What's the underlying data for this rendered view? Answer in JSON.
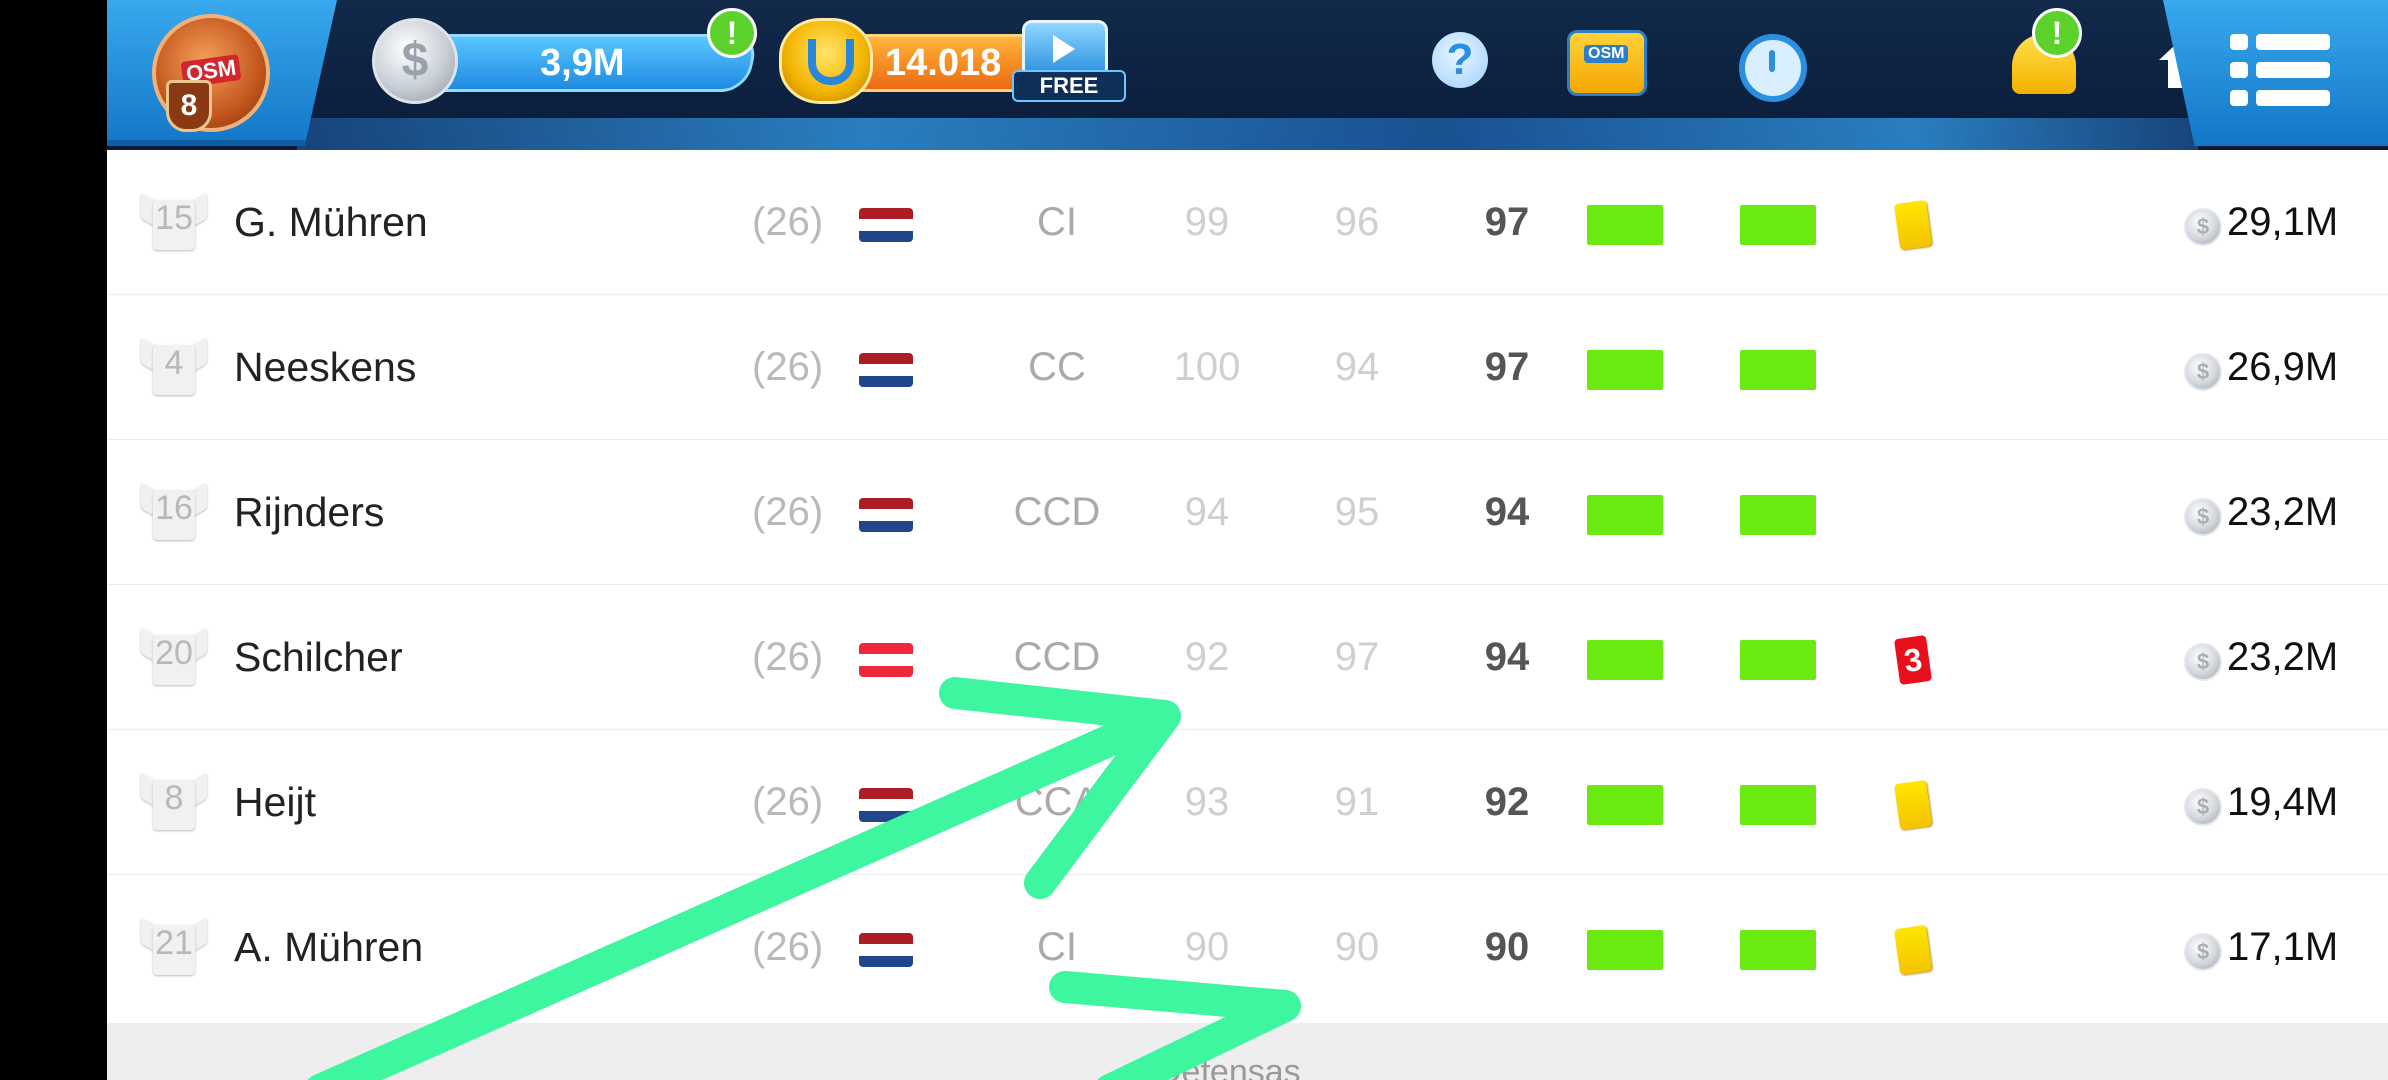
{
  "header": {
    "logo_text": "OSM",
    "level": "8",
    "coins": "3,9M",
    "coins_alert": "!",
    "boss_coins": "14.018",
    "boss_alert": "!",
    "free_video_label": "FREE",
    "help_glyph": "?",
    "bag_label": "OSM",
    "bell_alert": "!",
    "icons": [
      "coin-icon",
      "bosscoin-icon",
      "video-camera-icon",
      "help-icon",
      "shop-bag-icon",
      "stopwatch-icon",
      "bell-icon",
      "home-icon",
      "menu-icon"
    ]
  },
  "players": [
    {
      "number": "15",
      "name": "G. Mühren",
      "age": "(26)",
      "flag": "netherlands",
      "position": "CI",
      "stat1": "99",
      "stat2": "96",
      "overall": "97",
      "card": "yellow",
      "card_text": "",
      "value": "29,1M"
    },
    {
      "number": "4",
      "name": "Neeskens",
      "age": "(26)",
      "flag": "netherlands",
      "position": "CC",
      "stat1": "100",
      "stat2": "94",
      "overall": "97",
      "card": "",
      "card_text": "",
      "value": "26,9M"
    },
    {
      "number": "16",
      "name": "Rijnders",
      "age": "(26)",
      "flag": "netherlands",
      "position": "CCD",
      "stat1": "94",
      "stat2": "95",
      "overall": "94",
      "card": "",
      "card_text": "",
      "value": "23,2M"
    },
    {
      "number": "20",
      "name": "Schilcher",
      "age": "(26)",
      "flag": "austria",
      "position": "CCD",
      "stat1": "92",
      "stat2": "97",
      "overall": "94",
      "card": "red",
      "card_text": "3",
      "value": "23,2M"
    },
    {
      "number": "8",
      "name": "Heijt",
      "age": "(26)",
      "flag": "netherlands",
      "position": "CCA",
      "stat1": "93",
      "stat2": "91",
      "overall": "92",
      "card": "yellow",
      "card_text": "",
      "value": "19,4M"
    },
    {
      "number": "21",
      "name": "A. Mühren",
      "age": "(26)",
      "flag": "netherlands",
      "position": "CI",
      "stat1": "90",
      "stat2": "90",
      "overall": "90",
      "card": "yellow",
      "card_text": "",
      "value": "17,1M"
    }
  ],
  "footer": {
    "section_label": "Defensas"
  },
  "colors": {
    "accent_green": "#6bea12",
    "annotation_arrow": "#3ef5a0",
    "topbar": "#0b1f3d",
    "tab_blue": "#1f8ae2",
    "flag_netherlands": [
      "#ae1c28",
      "#ffffff",
      "#21468b"
    ],
    "flag_austria": [
      "#ed2939",
      "#ffffff",
      "#ed2939"
    ]
  }
}
